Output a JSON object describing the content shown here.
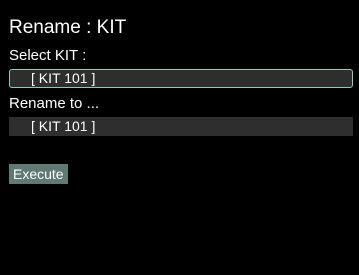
{
  "header": {
    "title": "Rename : KIT"
  },
  "select_kit": {
    "label": "Select KIT :",
    "value": "[ KIT 101 ]"
  },
  "rename_to": {
    "label": "Rename to ...",
    "value": "[ KIT 101 ]"
  },
  "actions": {
    "execute_label": "Execute"
  },
  "colors": {
    "background": "#000000",
    "text": "#ffffff",
    "field_bg": "#2e2e2e",
    "focus_border": "#7fd3b3",
    "button_bg": "#5f7a72"
  }
}
